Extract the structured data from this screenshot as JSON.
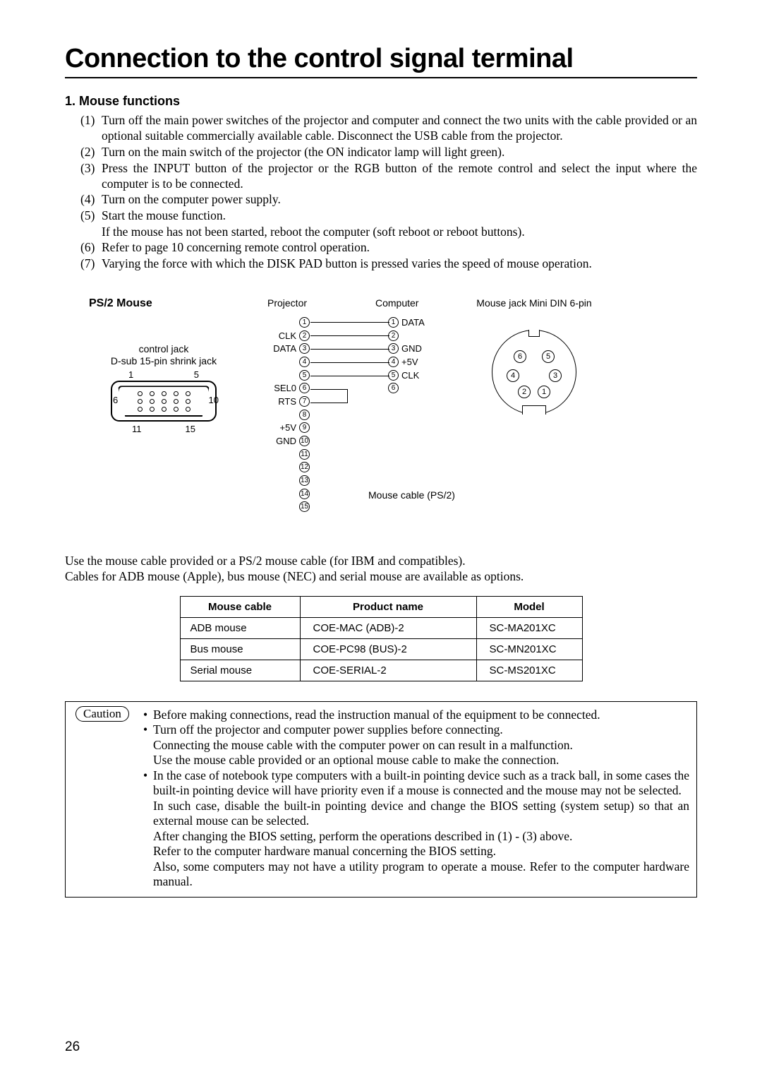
{
  "title": "Connection to the control signal terminal",
  "pageNumber": "26",
  "section1": {
    "heading": "1.  Mouse functions",
    "steps": [
      {
        "num": "(1)",
        "text": "Turn off the main power switches of the projector and computer and connect the two units with the cable provided or an optional suitable commercially available cable. Disconnect the USB cable from the projector."
      },
      {
        "num": "(2)",
        "text": "Turn on the main switch of the projector (the ON indicator lamp will light green)."
      },
      {
        "num": "(3)",
        "text": "Press the INPUT button of the projector or the RGB button of the remote control and select the input where the computer is to be connected."
      },
      {
        "num": "(4)",
        "text": "Turn on the computer power supply."
      },
      {
        "num": "(5)",
        "text": "Start the mouse function."
      },
      {
        "sub": true,
        "text": "If the mouse has not been started, reboot the computer (soft reboot or reboot buttons)."
      },
      {
        "num": "(6)",
        "text": "Refer to page 10 concerning remote control operation."
      },
      {
        "num": "(7)",
        "text": "Varying the force with which the DISK PAD button is pressed varies the speed of mouse operation."
      }
    ]
  },
  "diagram": {
    "ps2Label": "PS/2 Mouse",
    "controlJack": "control jack",
    "dsub": "D-sub 15-pin shrink jack",
    "dsubPins": {
      "n1": "1",
      "n5": "5",
      "n6": "6",
      "n10": "10",
      "n11": "11",
      "n15": "15"
    },
    "projectorTitle": "Projector",
    "computerTitle": "Computer",
    "mouseJackTitle": "Mouse jack  Mini DIN 6-pin",
    "projectorPins": [
      {
        "n": "1",
        "l": ""
      },
      {
        "n": "2",
        "l": "CLK"
      },
      {
        "n": "3",
        "l": "DATA"
      },
      {
        "n": "4",
        "l": ""
      },
      {
        "n": "5",
        "l": ""
      },
      {
        "n": "6",
        "l": "SEL0"
      },
      {
        "n": "7",
        "l": "RTS"
      },
      {
        "n": "8",
        "l": ""
      },
      {
        "n": "9",
        "l": "+5V"
      },
      {
        "n": "10",
        "l": "GND"
      },
      {
        "n": "11",
        "l": ""
      },
      {
        "n": "12",
        "l": ""
      },
      {
        "n": "13",
        "l": ""
      },
      {
        "n": "14",
        "l": ""
      },
      {
        "n": "15",
        "l": ""
      }
    ],
    "computerPins": [
      {
        "n": "1",
        "l": "DATA"
      },
      {
        "n": "2",
        "l": ""
      },
      {
        "n": "3",
        "l": "GND"
      },
      {
        "n": "4",
        "l": "+5V"
      },
      {
        "n": "5",
        "l": "CLK"
      },
      {
        "n": "6",
        "l": ""
      }
    ],
    "mdinPins": {
      "p1": "1",
      "p2": "2",
      "p3": "3",
      "p4": "4",
      "p5": "5",
      "p6": "6"
    },
    "cableLabel": "Mouse cable (PS/2)"
  },
  "notes": [
    "Use the mouse cable provided or a PS/2 mouse cable (for IBM and compatibles).",
    "Cables for ADB  mouse (Apple), bus mouse (NEC) and serial mouse are available as options."
  ],
  "table": {
    "headers": [
      "Mouse cable",
      "Product name",
      "Model"
    ],
    "rows": [
      [
        "ADB mouse",
        "COE-MAC (ADB)-2",
        "SC-MA201XC"
      ],
      [
        "Bus mouse",
        "COE-PC98 (BUS)-2",
        "SC-MN201XC"
      ],
      [
        "Serial mouse",
        "COE-SERIAL-2",
        "SC-MS201XC"
      ]
    ]
  },
  "caution": {
    "label": "Caution",
    "items": [
      {
        "type": "bullet",
        "text": "Before making connections, read the instruction manual of the equipment to be connected."
      },
      {
        "type": "bullet",
        "text": "Turn off the projector and computer power supplies before connecting."
      },
      {
        "type": "plain",
        "text": "Connecting the mouse cable with the computer power on can result in a malfunction."
      },
      {
        "type": "plain",
        "text": "Use the mouse cable provided or an optional mouse cable to make the connection."
      },
      {
        "type": "bullet",
        "text": "In the case of notebook type computers with a built-in pointing device such as a track ball, in some cases the built-in pointing device will have priority even if a mouse is connected and the mouse may not be selected."
      },
      {
        "type": "plain",
        "text": "In such case, disable the built-in pointing device and change the BIOS setting (system setup) so that an external mouse can be selected."
      },
      {
        "type": "plain",
        "text": "After changing the BIOS setting, perform the operations described in (1) - (3) above."
      },
      {
        "type": "plain",
        "text": "Refer to the computer hardware manual concerning the BIOS setting."
      },
      {
        "type": "plain",
        "text": "Also, some computers may not have a utility program to operate a mouse. Refer to the computer hardware manual."
      }
    ]
  }
}
